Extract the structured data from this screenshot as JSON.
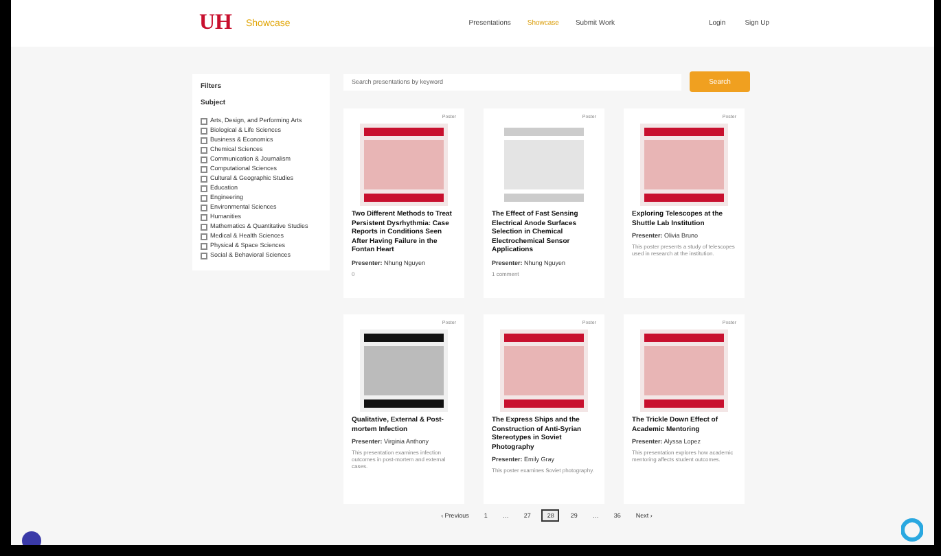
{
  "header": {
    "logo": "UH",
    "brand": "Showcase",
    "nav": [
      {
        "label": "Presentations",
        "selected": false
      },
      {
        "label": "Showcase",
        "selected": true
      },
      {
        "label": "Submit Work",
        "selected": false
      }
    ],
    "account": [
      "Login",
      "Sign Up"
    ]
  },
  "filters": {
    "title": "Filters",
    "group": "Subject",
    "items": [
      {
        "label": "Arts, Design, and Performing Arts",
        "checked": false
      },
      {
        "label": "Biological & Life Sciences",
        "checked": false
      },
      {
        "label": "Business & Economics",
        "checked": false
      },
      {
        "label": "Chemical Sciences",
        "checked": false
      },
      {
        "label": "Communication & Journalism",
        "checked": false
      },
      {
        "label": "Computational Sciences",
        "checked": false
      },
      {
        "label": "Cultural & Geographic Studies",
        "checked": false
      },
      {
        "label": "Education",
        "checked": false
      },
      {
        "label": "Engineering",
        "checked": false
      },
      {
        "label": "Environmental Sciences",
        "checked": false
      },
      {
        "label": "Humanities",
        "checked": false
      },
      {
        "label": "Mathematics & Quantitative Studies",
        "checked": false
      },
      {
        "label": "Medical & Health Sciences",
        "checked": false
      },
      {
        "label": "Physical & Space Sciences",
        "checked": false
      },
      {
        "label": "Social & Behavioral Sciences",
        "checked": false
      }
    ]
  },
  "search": {
    "placeholder": "Search presentations by keyword",
    "button": "Search"
  },
  "cards": [
    {
      "tag": "Poster",
      "kind": "red",
      "title": "Two Different Methods to Treat Persistent Dysrhythmia: Case Reports in Conditions Seen After Having Failure in the Fontan Heart",
      "presenter_label": "Presenter:",
      "presenter": "Nhung Nguyen",
      "note": "0"
    },
    {
      "tag": "Poster",
      "kind": "diagram",
      "title": "The Effect of Fast Sensing Electrical Anode Surfaces Selection in Chemical Electrochemical Sensor Applications",
      "presenter_label": "Presenter:",
      "presenter": "Nhung Nguyen",
      "note": "1 comment"
    },
    {
      "tag": "Poster",
      "kind": "red",
      "title": "Exploring Telescopes at the Shuttle Lab Institution",
      "presenter_label": "Presenter:",
      "presenter": "Olivia Bruno",
      "note": "This poster presents a study of telescopes used in research at the institution."
    },
    {
      "tag": "Poster",
      "kind": "bw",
      "title": "Qualitative, External & Post-mortem Infection",
      "presenter_label": "Presenter:",
      "presenter": "Virginia Anthony",
      "note": "This presentation examines infection outcomes in post-mortem and external cases."
    },
    {
      "tag": "Poster",
      "kind": "red",
      "title": "The Express Ships and the Construction of Anti-Syrian Stereotypes in Soviet Photography",
      "presenter_label": "Presenter:",
      "presenter": "Emily Gray",
      "note": "This poster examines Soviet photography."
    },
    {
      "tag": "Poster",
      "kind": "red",
      "title": "The Trickle Down Effect of Academic Mentoring",
      "presenter_label": "Presenter:",
      "presenter": "Alyssa Lopez",
      "note": "This presentation explores how academic mentoring affects student outcomes."
    }
  ],
  "pagination": [
    {
      "label": "‹ Previous",
      "selected": false
    },
    {
      "label": "1",
      "selected": false
    },
    {
      "label": "…",
      "selected": false
    },
    {
      "label": "27",
      "selected": false
    },
    {
      "label": "28",
      "selected": true
    },
    {
      "label": "29",
      "selected": false
    },
    {
      "label": "…",
      "selected": false
    },
    {
      "label": "36",
      "selected": false
    },
    {
      "label": "Next ›",
      "selected": false
    }
  ]
}
